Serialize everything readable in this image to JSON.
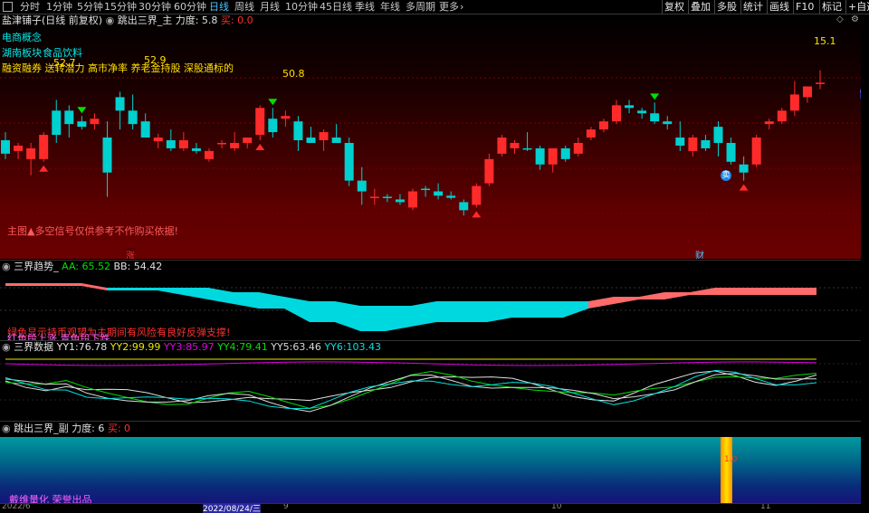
{
  "toolbar": {
    "tabs": [
      "分时",
      "1分钟",
      "5分钟",
      "15分钟",
      "30分钟",
      "60分钟",
      "日线",
      "周线",
      "月线",
      "10分钟",
      "45日线",
      "季线",
      "年线",
      "多周期",
      "更多"
    ],
    "active_tab": "日线",
    "right_buttons": [
      "复权",
      "叠加",
      "多股",
      "统计",
      "画线",
      "F10",
      "标记",
      "+自选"
    ]
  },
  "main": {
    "stock_title": "盐津铺子(日线 前复权)",
    "indicator_name": "跳出三界_主",
    "force_label": "力度:",
    "force_value": "5.8",
    "buy_label": "买:",
    "buy_value": "0.0",
    "concepts": [
      "电商概念",
      "湖南板块",
      "食品饮料"
    ],
    "concept_line3": "融资融券 送转潜力 高市净率 养老金持股 深股通标的",
    "disclaimer": "主图▲多空信号仅供参考不作购买依据!",
    "price_labels": [
      "52.7",
      "52.9",
      "50.8",
      "15.1"
    ],
    "right_axis_label": "95",
    "marker_zhang": "涨",
    "marker_cai": "财",
    "marker_mai": "卖"
  },
  "trend": {
    "name": "三界趋势_",
    "aa_label": "AA:",
    "aa_value": "65.52",
    "bb_label": "BB:",
    "bb_value": "54.42",
    "note1": "绿色显示持币观望为主期间有风险有良好反弹支撑!",
    "note2": "红色段上涨 青色段下跌"
  },
  "data_panel": {
    "name": "三界数据",
    "items": [
      {
        "label": "YY1:",
        "value": "76.78",
        "color": "#e0e0e0"
      },
      {
        "label": "YY2:",
        "value": "99.99",
        "color": "#e6e600"
      },
      {
        "label": "YY3:",
        "value": "85.97",
        "color": "#e000e0"
      },
      {
        "label": "YY4:",
        "value": "79.41",
        "color": "#00e000"
      },
      {
        "label": "YY5:",
        "value": "63.46",
        "color": "#d8d8d8"
      },
      {
        "label": "YY6:",
        "value": "103.43",
        "color": "#00e0e0"
      }
    ]
  },
  "sub": {
    "name": "跳出三界_副",
    "force_label": "力度:",
    "force_value": "6",
    "buy_label": "买:",
    "buy_value": "0",
    "bar_label": "1.0",
    "brand": "戴维量化 荣誉出品"
  },
  "date_axis": {
    "start": "2022/6",
    "cursor": "2022/08/24/三",
    "months": [
      "9",
      "10",
      "11"
    ]
  },
  "colors": {
    "up": "#ff2b2b",
    "down": "#00d0d0",
    "background": "#000000",
    "grid": "#7a0000",
    "accent": "#4fc3ff"
  },
  "chart_data": {
    "type": "candlestick",
    "y_range": [
      12,
      16
    ],
    "candles": [
      {
        "o": 14.0,
        "h": 14.15,
        "l": 13.65,
        "c": 13.75
      },
      {
        "o": 13.8,
        "h": 13.95,
        "l": 13.65,
        "c": 13.9
      },
      {
        "o": 13.65,
        "h": 13.95,
        "l": 13.35,
        "c": 13.85
      },
      {
        "o": 13.65,
        "h": 14.15,
        "l": 13.6,
        "c": 14.1
      },
      {
        "o": 14.55,
        "h": 14.75,
        "l": 13.95,
        "c": 14.1
      },
      {
        "o": 14.55,
        "h": 14.65,
        "l": 14.05,
        "c": 14.3
      },
      {
        "o": 14.35,
        "h": 14.45,
        "l": 14.2,
        "c": 14.25
      },
      {
        "o": 14.3,
        "h": 14.5,
        "l": 14.2,
        "c": 14.4
      },
      {
        "o": 14.05,
        "h": 14.35,
        "l": 12.95,
        "c": 13.4
      },
      {
        "o": 14.8,
        "h": 14.9,
        "l": 14.2,
        "c": 14.55
      },
      {
        "o": 14.55,
        "h": 14.85,
        "l": 14.2,
        "c": 14.3
      },
      {
        "o": 14.35,
        "h": 14.5,
        "l": 14.05,
        "c": 14.05
      },
      {
        "o": 13.98,
        "h": 14.12,
        "l": 13.85,
        "c": 14.05
      },
      {
        "o": 14.0,
        "h": 14.2,
        "l": 13.8,
        "c": 13.85
      },
      {
        "o": 13.85,
        "h": 14.15,
        "l": 13.8,
        "c": 14.0
      },
      {
        "o": 13.85,
        "h": 13.95,
        "l": 13.75,
        "c": 13.8
      },
      {
        "o": 13.65,
        "h": 13.85,
        "l": 13.6,
        "c": 13.8
      },
      {
        "o": 13.95,
        "h": 14.0,
        "l": 13.85,
        "c": 13.95
      },
      {
        "o": 13.85,
        "h": 14.15,
        "l": 13.8,
        "c": 13.95
      },
      {
        "o": 13.95,
        "h": 14.05,
        "l": 13.85,
        "c": 14.05
      },
      {
        "o": 14.1,
        "h": 14.65,
        "l": 14.0,
        "c": 14.6
      },
      {
        "o": 14.4,
        "h": 14.6,
        "l": 14.05,
        "c": 14.15
      },
      {
        "o": 14.4,
        "h": 14.55,
        "l": 14.25,
        "c": 14.45
      },
      {
        "o": 14.35,
        "h": 14.45,
        "l": 13.8,
        "c": 14.0
      },
      {
        "o": 14.05,
        "h": 14.25,
        "l": 13.95,
        "c": 13.95
      },
      {
        "o": 14.0,
        "h": 14.2,
        "l": 13.8,
        "c": 14.15
      },
      {
        "o": 14.05,
        "h": 14.3,
        "l": 13.95,
        "c": 13.95
      },
      {
        "o": 13.95,
        "h": 14.05,
        "l": 13.15,
        "c": 13.25
      },
      {
        "o": 13.25,
        "h": 13.5,
        "l": 12.8,
        "c": 13.05
      },
      {
        "o": 12.95,
        "h": 13.1,
        "l": 12.8,
        "c": 12.95
      },
      {
        "o": 12.95,
        "h": 13.0,
        "l": 12.85,
        "c": 12.93
      },
      {
        "o": 12.9,
        "h": 13.0,
        "l": 12.8,
        "c": 12.85
      },
      {
        "o": 12.75,
        "h": 13.1,
        "l": 12.7,
        "c": 13.05
      },
      {
        "o": 13.1,
        "h": 13.15,
        "l": 12.95,
        "c": 13.08
      },
      {
        "o": 13.05,
        "h": 13.2,
        "l": 12.9,
        "c": 12.97
      },
      {
        "o": 12.97,
        "h": 13.05,
        "l": 12.9,
        "c": 12.93
      },
      {
        "o": 12.85,
        "h": 12.9,
        "l": 12.6,
        "c": 12.7
      },
      {
        "o": 12.8,
        "h": 13.2,
        "l": 12.75,
        "c": 13.15
      },
      {
        "o": 13.2,
        "h": 13.75,
        "l": 13.15,
        "c": 13.65
      },
      {
        "o": 13.75,
        "h": 14.1,
        "l": 13.7,
        "c": 14.05
      },
      {
        "o": 13.85,
        "h": 14.0,
        "l": 13.75,
        "c": 13.95
      },
      {
        "o": 13.85,
        "h": 14.15,
        "l": 13.8,
        "c": 13.84
      },
      {
        "o": 13.85,
        "h": 13.9,
        "l": 13.45,
        "c": 13.55
      },
      {
        "o": 13.55,
        "h": 13.85,
        "l": 13.4,
        "c": 13.85
      },
      {
        "o": 13.85,
        "h": 13.9,
        "l": 13.6,
        "c": 13.65
      },
      {
        "o": 13.75,
        "h": 14.05,
        "l": 13.7,
        "c": 13.95
      },
      {
        "o": 14.05,
        "h": 14.25,
        "l": 14.0,
        "c": 14.2
      },
      {
        "o": 14.2,
        "h": 14.4,
        "l": 14.15,
        "c": 14.35
      },
      {
        "o": 14.35,
        "h": 14.75,
        "l": 14.3,
        "c": 14.65
      },
      {
        "o": 14.65,
        "h": 14.75,
        "l": 14.5,
        "c": 14.6
      },
      {
        "o": 14.55,
        "h": 14.6,
        "l": 14.4,
        "c": 14.5
      },
      {
        "o": 14.5,
        "h": 14.7,
        "l": 14.3,
        "c": 14.35
      },
      {
        "o": 14.35,
        "h": 14.45,
        "l": 14.2,
        "c": 14.3
      },
      {
        "o": 14.05,
        "h": 14.35,
        "l": 13.8,
        "c": 13.9
      },
      {
        "o": 13.8,
        "h": 14.1,
        "l": 13.7,
        "c": 14.05
      },
      {
        "o": 14.0,
        "h": 14.1,
        "l": 13.8,
        "c": 13.85
      },
      {
        "o": 14.25,
        "h": 14.35,
        "l": 13.7,
        "c": 13.95
      },
      {
        "o": 13.95,
        "h": 14.05,
        "l": 13.55,
        "c": 13.6
      },
      {
        "o": 13.55,
        "h": 13.7,
        "l": 13.25,
        "c": 13.4
      },
      {
        "o": 13.55,
        "h": 14.1,
        "l": 13.5,
        "c": 14.05
      },
      {
        "o": 14.3,
        "h": 14.4,
        "l": 14.2,
        "c": 14.35
      },
      {
        "o": 14.35,
        "h": 14.6,
        "l": 14.3,
        "c": 14.55
      },
      {
        "o": 14.55,
        "h": 15.1,
        "l": 14.45,
        "c": 14.85
      },
      {
        "o": 14.8,
        "h": 15.0,
        "l": 14.7,
        "c": 15.0
      },
      {
        "o": 15.05,
        "h": 15.3,
        "l": 14.95,
        "c": 15.07
      }
    ],
    "trend_aa": [
      4,
      4,
      4,
      4,
      3,
      3,
      3,
      2,
      1,
      0,
      -1,
      -1,
      -4,
      -4,
      -6,
      -6,
      -5,
      -4,
      -4,
      -4,
      -3,
      -3,
      -3,
      -1,
      0,
      1,
      1,
      2,
      3,
      3,
      3,
      3,
      3
    ],
    "trend_bb": [
      4,
      4,
      4,
      4,
      3,
      3,
      3,
      3,
      3,
      2,
      2,
      1,
      0,
      0,
      -1,
      -1,
      -1,
      0,
      0,
      0,
      0,
      0,
      0,
      0,
      1,
      1,
      2,
      2,
      2,
      2,
      2,
      2,
      2
    ]
  }
}
